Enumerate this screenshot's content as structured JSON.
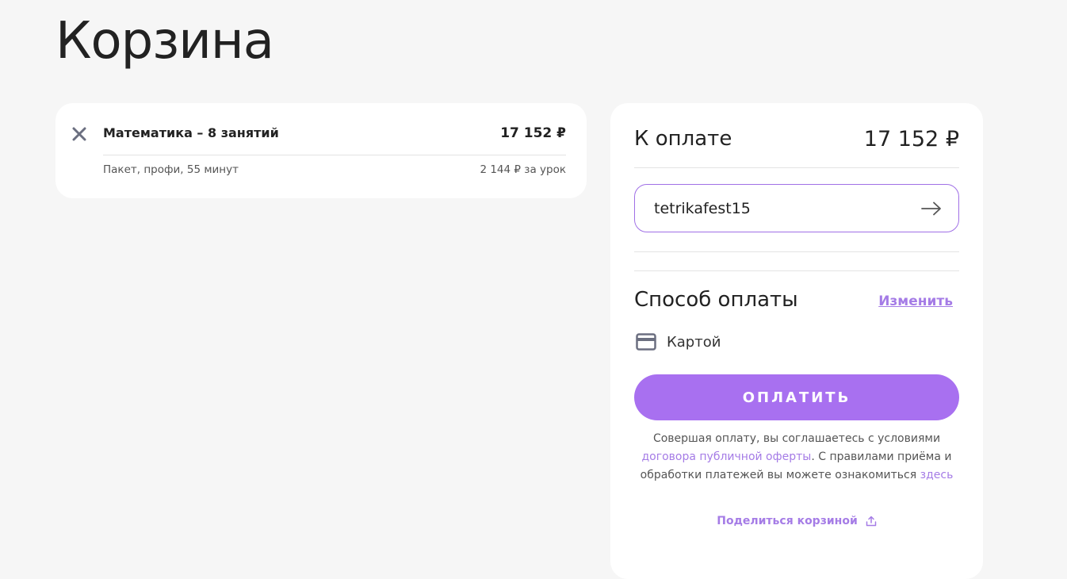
{
  "page": {
    "title": "Корзина"
  },
  "cart": {
    "items": [
      {
        "title": "Математика – 8 занятий",
        "price": "17 152 ₽",
        "subtitle": "Пакет, профи, 55 минут",
        "unit_price": "2 144 ₽ за урок"
      }
    ]
  },
  "checkout": {
    "total_label": "К оплате",
    "total_amount": "17 152 ₽",
    "promo_code_value": "tetrikafest15",
    "payment_method_heading": "Способ оплаты",
    "change_label": "Изменить",
    "payment_method": "Картой",
    "pay_button_label": "ОПЛАТИТЬ",
    "legal": {
      "text_1": "Совершая оплату, вы соглашаетесь с условиями ",
      "offer_link": "договора публичной оферты",
      "text_2": ". С правилами приёма и обработки платежей вы можете ознакомиться ",
      "here_link": "здесь"
    },
    "share_label": "Поделиться корзиной"
  },
  "icons": {
    "remove": "close-icon",
    "promo_apply": "arrow-right-icon",
    "payment_card": "credit-card-icon",
    "share": "share-icon"
  },
  "colors": {
    "accent": "#a870f0",
    "link": "#a57ce6",
    "background": "#f6f6f6",
    "card": "#ffffff"
  }
}
